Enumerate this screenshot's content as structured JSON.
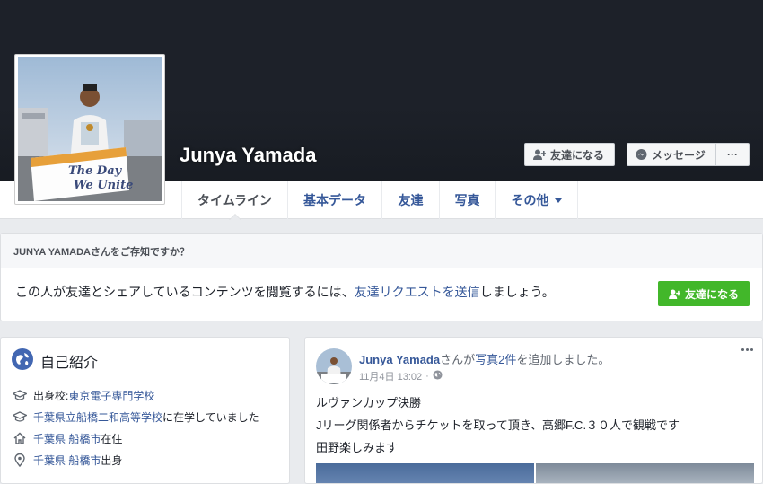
{
  "profile": {
    "name": "Junya Yamada",
    "add_friend_label": "友達になる",
    "message_label": "メッセージ",
    "more_label": "···"
  },
  "tabs": [
    {
      "label": "タイムライン",
      "active": true
    },
    {
      "label": "基本データ"
    },
    {
      "label": "友達"
    },
    {
      "label": "写真"
    },
    {
      "label": "その他"
    }
  ],
  "friend_panel": {
    "heading": "JUNYA YAMADAさんをご存知ですか？",
    "text_before": "この人が友達とシェアしているコンテンツを閲覧するには、",
    "link_text": "友達リクエストを送信",
    "text_after": "しましょう。",
    "button_label": "友達になる"
  },
  "intro": {
    "title": "自己紹介",
    "items": [
      {
        "icon": "graduation-cap-icon",
        "prefix": "出身校: ",
        "link": "東京電子専門学校",
        "suffix": ""
      },
      {
        "icon": "graduation-cap-icon",
        "prefix": "",
        "link": "千葉県立船橋二和高等学校",
        "suffix": "に在学していました"
      },
      {
        "icon": "home-icon",
        "prefix": "",
        "link": "千葉県 船橋市",
        "suffix": "在住"
      },
      {
        "icon": "location-pin-icon",
        "prefix": "",
        "link": "千葉県 船橋市",
        "suffix": "出身"
      }
    ]
  },
  "post": {
    "author": "Junya Yamada",
    "action_prefix": "さんが",
    "action_link": "写真2件",
    "action_suffix": "を追加しました。",
    "date": "11月4日 13:02",
    "separator": "·",
    "privacy_icon": "globe-icon",
    "lines": [
      "ルヴァンカップ決勝",
      "Jリーグ関係者からチケットを取って頂き、高郷F.C.３０人で観戦です",
      "田野楽しみます"
    ]
  },
  "colors": {
    "cover": "#1d2129",
    "link": "#365899",
    "green_button": "#42b72a",
    "page_bg": "#e9ebee"
  }
}
